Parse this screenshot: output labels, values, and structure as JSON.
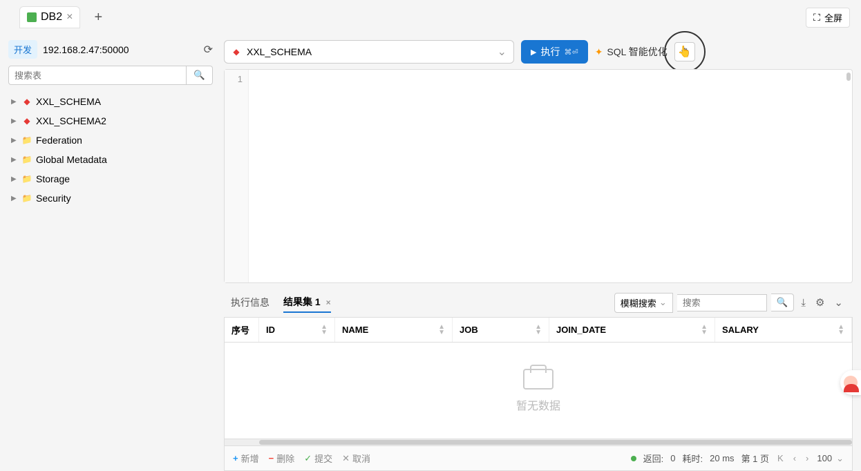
{
  "tab": {
    "name": "DB2"
  },
  "fullscreen": "全屏",
  "sidebar": {
    "badge": "开发",
    "address": "192.168.2.47:50000",
    "search_placeholder": "搜索表",
    "tree": [
      {
        "icon": "schema",
        "label": "XXL_SCHEMA"
      },
      {
        "icon": "schema",
        "label": "XXL_SCHEMA2"
      },
      {
        "icon": "folder",
        "label": "Federation"
      },
      {
        "icon": "folder",
        "label": "Global Metadata"
      },
      {
        "icon": "folder",
        "label": "Storage"
      },
      {
        "icon": "folder",
        "label": "Security"
      }
    ]
  },
  "toolbar": {
    "selected_schema": "XXL_SCHEMA",
    "exec": "执行",
    "exec_shortcut": "⌘⏎",
    "ai": "SQL 智能优化"
  },
  "editor": {
    "line": "1"
  },
  "results": {
    "tabs": {
      "info": "执行信息",
      "set": "结果集 1"
    },
    "search_type": "模糊搜索",
    "search_placeholder": "搜索",
    "columns": {
      "seq": "序号",
      "id": "ID",
      "name": "NAME",
      "job": "JOB",
      "join_date": "JOIN_DATE",
      "salary": "SALARY"
    },
    "empty": "暂无数据"
  },
  "footer": {
    "add": "新增",
    "del": "删除",
    "commit": "提交",
    "cancel": "取消",
    "return_label": "返回:",
    "return_count": "0",
    "time_label": "耗时:",
    "time_value": "20 ms",
    "page_label": "第 1 页",
    "k": "K",
    "page_size": "100"
  }
}
